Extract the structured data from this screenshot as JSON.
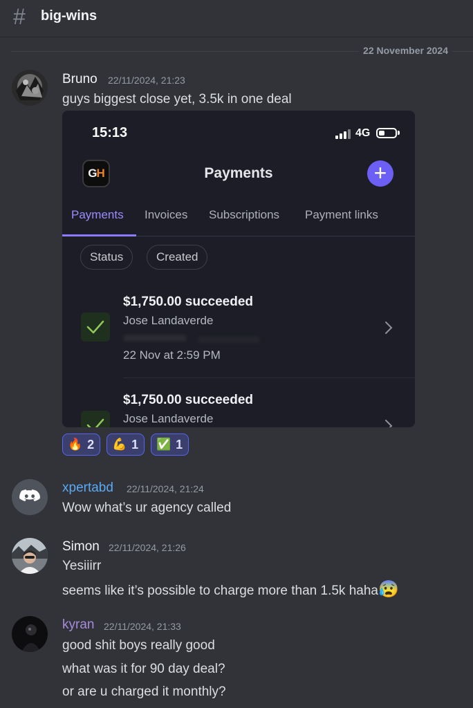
{
  "channel": {
    "name": "big-wins"
  },
  "date_divider": "22 November 2024",
  "messages": [
    {
      "author": "Bruno",
      "author_color": "#f2f3f5",
      "timestamp": "22/11/2024, 21:23",
      "lines": [
        "guys biggest close yet, 3.5k in one deal"
      ]
    },
    {
      "author": "xpertabd",
      "author_color": "#5aa9f5",
      "timestamp": "22/11/2024, 21:24",
      "lines": [
        "Wow what’s ur agency called"
      ]
    },
    {
      "author": "Simon",
      "author_color": "#f2f3f5",
      "timestamp": "22/11/2024, 21:26",
      "lines": [
        "Yesiiirr",
        "seems like it’s possible to charge more than 1.5k haha"
      ]
    },
    {
      "author": "kyran",
      "author_color": "#a78bdb",
      "timestamp": "22/11/2024, 21:33",
      "lines": [
        "good shit boys really good",
        "what was it for 90 day deal?",
        "or are u charged it monthly?"
      ]
    }
  ],
  "attachment": {
    "status_bar": {
      "time": "15:13",
      "network": "4G"
    },
    "app_logo": {
      "left": "G",
      "right": "H"
    },
    "title": "Payments",
    "add_button": "+",
    "tabs": [
      "Payments",
      "Invoices",
      "Subscriptions",
      "Payment links"
    ],
    "active_tab": "Payments",
    "filters": [
      "Status",
      "Created"
    ],
    "payments": [
      {
        "amount": "$1,750.00 succeeded",
        "customer": "Jose Landaverde",
        "date": "22 Nov at 2:59 PM"
      },
      {
        "amount": "$1,750.00 succeeded",
        "customer": "Jose Landaverde"
      }
    ]
  },
  "reactions": [
    {
      "emoji": "🔥",
      "count": "2"
    },
    {
      "emoji": "💪",
      "count": "1"
    },
    {
      "emoji": "✅",
      "count": "1"
    }
  ],
  "inline_emoji": "😰",
  "colors": {
    "background": "#323339",
    "accent": "#5865f2",
    "timestamp": "#949ba4"
  }
}
